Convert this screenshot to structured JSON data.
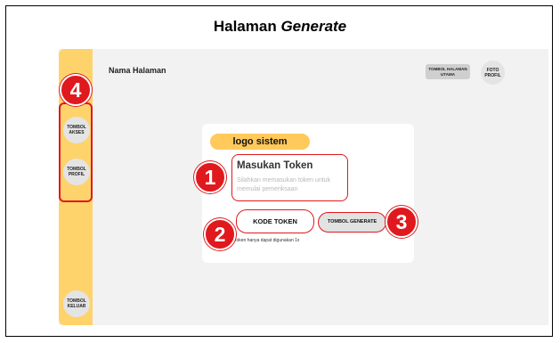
{
  "document": {
    "title_plain": "Halaman ",
    "title_italic": "Generate"
  },
  "sidebar": {
    "akses_label": "TOMBOL AKSES",
    "profil_label": "TOMBOL PROFIL",
    "keluar_label": "TOMBOL KELUAR",
    "color": "#ffd36b"
  },
  "header": {
    "page_name": "Nama Halaman",
    "home_button": "TOMBOL HALAMAN UTAMA",
    "profile_photo": "FOTO PROFIL"
  },
  "card": {
    "logo": "logo sistem",
    "token_title": "Masukan Token",
    "token_placeholder": "Silahkan memasukan token untuk memulai pemeriksaan",
    "kode_button": "KODE TOKEN",
    "generate_button": "TOMBOL GENERATE",
    "note": "Token hanya dapat digunakan 1x"
  },
  "markers": {
    "m1": "1",
    "m2": "2",
    "m3": "3",
    "m4": "4",
    "color": "#e0191e"
  }
}
